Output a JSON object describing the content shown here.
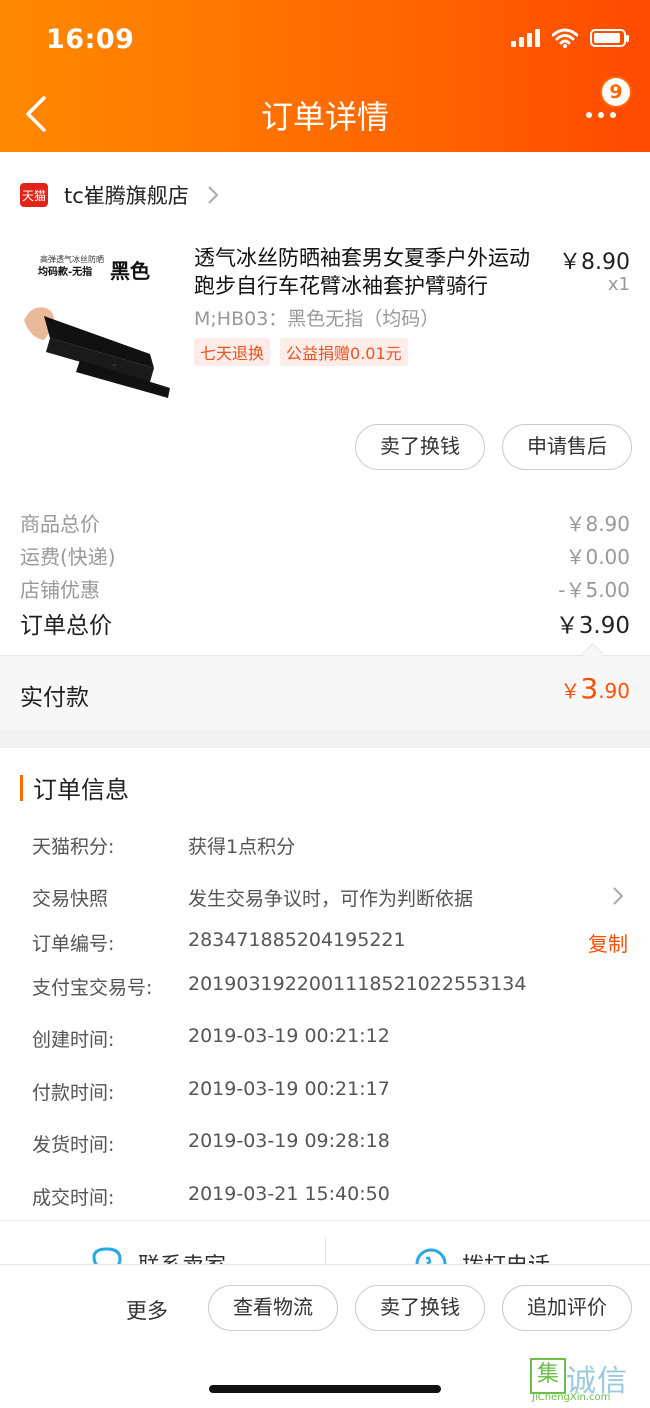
{
  "status_bar": {
    "time": "16:09"
  },
  "nav": {
    "title": "订单详情",
    "badge_count": "9"
  },
  "store": {
    "badge": "天猫",
    "name": "tc崔腾旗舰店"
  },
  "product": {
    "image_text_small": "高弹透气冰丝防晒",
    "image_text_mid": "均码款-无指",
    "image_text_big": "黑色",
    "name": "透气冰丝防晒袖套男女夏季户外运动跑步自行车花臂冰袖套护臂骑行",
    "price": "￥8.90",
    "quantity": "x1",
    "spec": "M;HB03：黑色无指（均码）",
    "tags": [
      "七天退换",
      "公益捐赠0.01元"
    ]
  },
  "item_buttons": {
    "sell": "卖了换钱",
    "after_sale": "申请售后"
  },
  "summary": {
    "rows": [
      {
        "label": "商品总价",
        "value": "￥8.90"
      },
      {
        "label": "运费(快递)",
        "value": "￥0.00"
      },
      {
        "label": "店铺优惠",
        "value": "-￥5.00"
      }
    ],
    "total_label": "订单总价",
    "total_value": "￥3.90",
    "paid_label": "实付款",
    "paid_currency": "￥",
    "paid_int": "3",
    "paid_dec": ".90"
  },
  "order_info": {
    "title": "订单信息",
    "points_label": "天猫积分:",
    "points_value": "获得1点积分",
    "snapshot_label": "交易快照",
    "snapshot_value": "发生交易争议时，可作为判断依据",
    "order_no_label": "订单编号:",
    "order_no_value": "283471885204195221",
    "copy": "复制",
    "alipay_label": "支付宝交易号:",
    "alipay_value": "2019031922001118521022553134",
    "created_label": "创建时间:",
    "created_value": "2019-03-19 00:21:12",
    "paid_label": "付款时间:",
    "paid_value": "2019-03-19 00:21:17",
    "shipped_label": "发货时间:",
    "shipped_value": "2019-03-19 09:28:18",
    "done_label": "成交时间:",
    "done_value": "2019-03-21 15:40:50"
  },
  "contact": {
    "seller": "联系卖家",
    "phone": "拨打电话"
  },
  "bottom_bar": {
    "more": "更多",
    "logistics": "查看物流",
    "sell": "卖了换钱",
    "review": "追加评价"
  },
  "watermark": {
    "glyph": "集",
    "text": "诚信",
    "url": "JiChengXin.com"
  },
  "colors": {
    "accent": "#ff6a00",
    "price_red": "#ff5000",
    "tmall_red": "#e2231a"
  }
}
